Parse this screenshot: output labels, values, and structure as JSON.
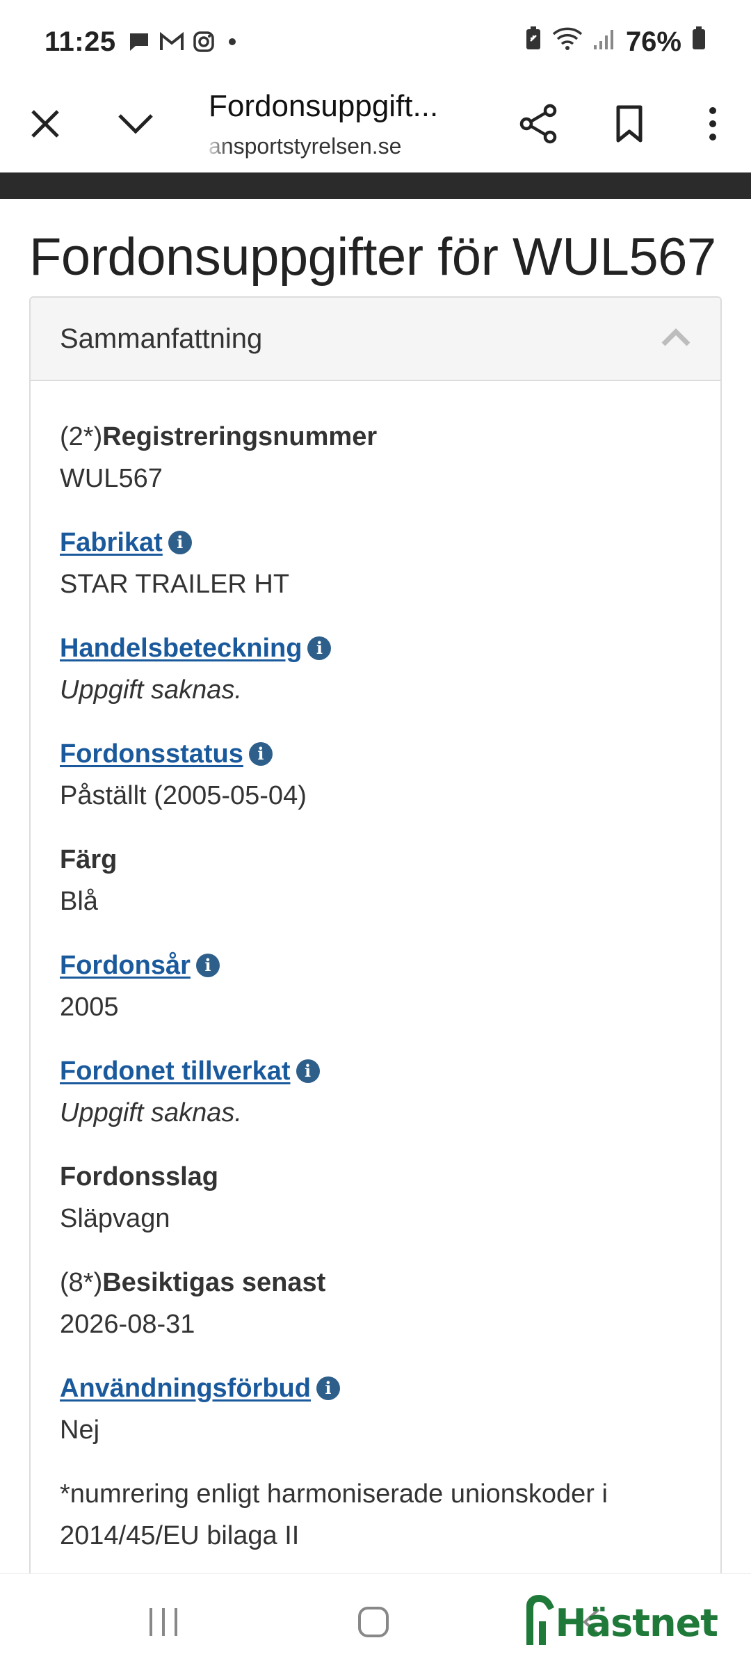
{
  "status_bar": {
    "time": "11:25",
    "battery": "76%",
    "left_icons": [
      "chat-icon",
      "gmail-icon",
      "instagram-icon",
      "dot-icon"
    ],
    "right_icons": [
      "battery-saver-icon",
      "wifi-icon",
      "signal-icon",
      "battery-icon"
    ]
  },
  "browser": {
    "title": "Fordonsuppgift...",
    "url": "ansportstyrelsen.se"
  },
  "page": {
    "title": "Fordonsuppgifter för WUL567",
    "panel_title": "Sammanfattning"
  },
  "fields": [
    {
      "prefix": "(2*)",
      "label": "Registreringsnummer",
      "link": false,
      "info": false,
      "value": "WUL567",
      "italic": false
    },
    {
      "prefix": "",
      "label": "Fabrikat",
      "link": true,
      "info": true,
      "value": "STAR TRAILER HT",
      "italic": false
    },
    {
      "prefix": "",
      "label": "Handelsbeteckning",
      "link": true,
      "info": true,
      "value": "Uppgift saknas.",
      "italic": true
    },
    {
      "prefix": "",
      "label": "Fordonsstatus",
      "link": true,
      "info": true,
      "value": "Påställt (2005-05-04)",
      "italic": false
    },
    {
      "prefix": "",
      "label": "Färg",
      "link": false,
      "info": false,
      "value": "Blå",
      "italic": false
    },
    {
      "prefix": "",
      "label": "Fordonsår",
      "link": true,
      "info": true,
      "value": "2005",
      "italic": false
    },
    {
      "prefix": "",
      "label": "Fordonet tillverkat",
      "link": true,
      "info": true,
      "value": "Uppgift saknas.",
      "italic": true
    },
    {
      "prefix": "",
      "label": "Fordonsslag",
      "link": false,
      "info": false,
      "value": "Släpvagn",
      "italic": false
    },
    {
      "prefix": "(8*)",
      "label": "Besiktigas senast",
      "link": false,
      "info": false,
      "value": "2026-08-31",
      "italic": false
    },
    {
      "prefix": "",
      "label": "Användningsförbud",
      "link": true,
      "info": true,
      "value": "Nej",
      "italic": false
    }
  ],
  "footnote": "*numrering enligt harmoniserade unionskoder i 2014/45/EU bilaga II",
  "info_glyph": "i",
  "brand": "Hästnet",
  "colors": {
    "link": "#1a5a9c",
    "info_icon": "#2d5f8a",
    "brand": "#1f7a3a",
    "panel_header": "#f5f5f5"
  }
}
